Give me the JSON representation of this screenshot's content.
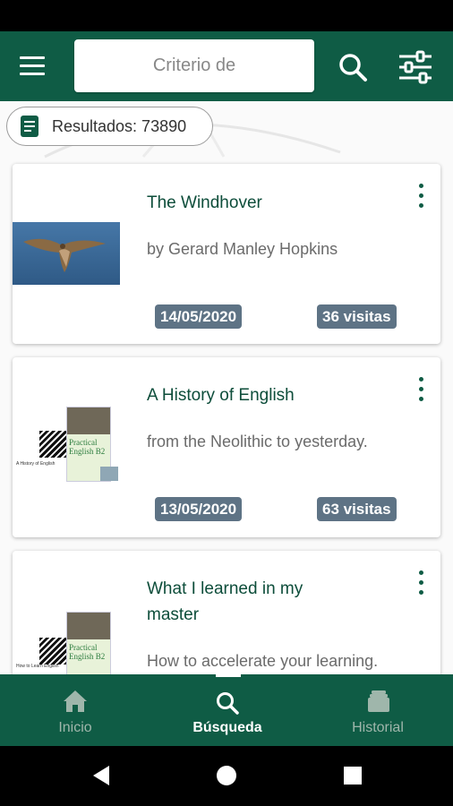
{
  "search": {
    "placeholder": "Criterio de"
  },
  "results": {
    "label": "Resultados: 73890"
  },
  "cards": [
    {
      "title": "The Windhover",
      "subtitle": "by Gerard Manley Hopkins",
      "date": "14/05/2020",
      "visits": "36 visitas"
    },
    {
      "title": "A History of English",
      "subtitle": "from the Neolithic to yesterday.",
      "date": "13/05/2020",
      "visits": "63 visitas",
      "thumb_text": {
        "left": "A History of English",
        "book": "Practical English B2"
      }
    },
    {
      "title": "What I learned in my master",
      "subtitle": "How to accelerate your learning.",
      "thumb_text": {
        "left": "How to Learn English",
        "book": "Practical English B2"
      }
    }
  ],
  "nav": {
    "home": "Inicio",
    "search": "Búsqueda",
    "history": "Historial"
  },
  "colors": {
    "primary": "#0f5c45",
    "badge": "#5e7385",
    "title": "#0d4d3a"
  },
  "icons": [
    "menu-icon",
    "search-icon",
    "filter-icon",
    "more-vert-icon",
    "document-icon",
    "home-icon",
    "history-icon",
    "back-icon",
    "home-circle-icon",
    "recents-icon"
  ]
}
